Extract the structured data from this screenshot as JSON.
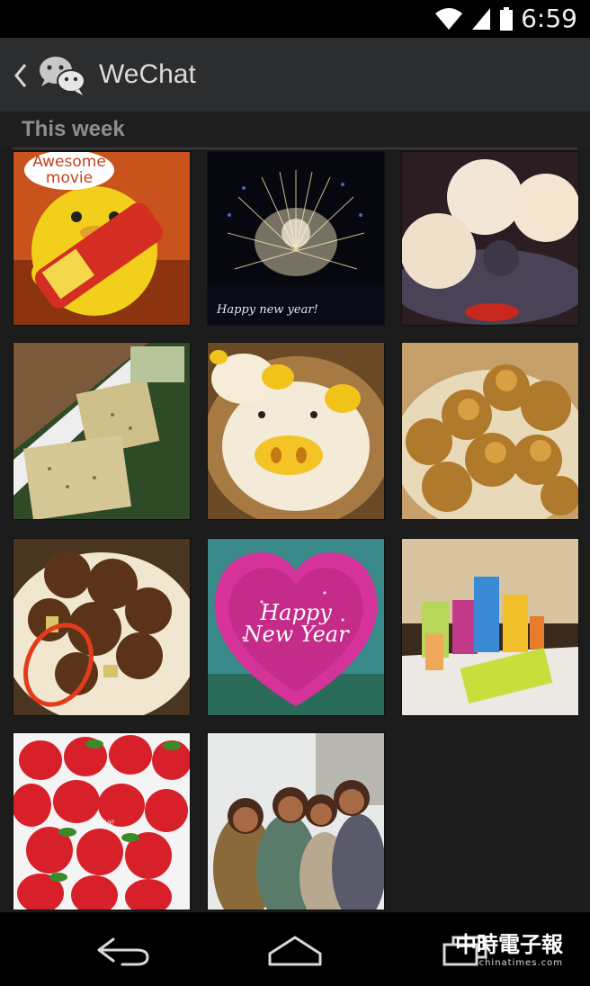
{
  "status_bar": {
    "time": "6:59"
  },
  "action_bar": {
    "title": "WeChat"
  },
  "section": {
    "title": "This week"
  },
  "photos": [
    {
      "caption_line1": "Awesome",
      "caption_line2": "movie",
      "label_text": ""
    },
    {
      "caption": "Happy new year!"
    },
    {},
    {},
    {},
    {},
    {},
    {
      "caption_line1": "Happy",
      "caption_line2": "New Year"
    },
    {},
    {
      "caption": "Love"
    },
    {}
  ],
  "watermark": {
    "main": "中時電子報",
    "sub": "chinatimes.com"
  }
}
